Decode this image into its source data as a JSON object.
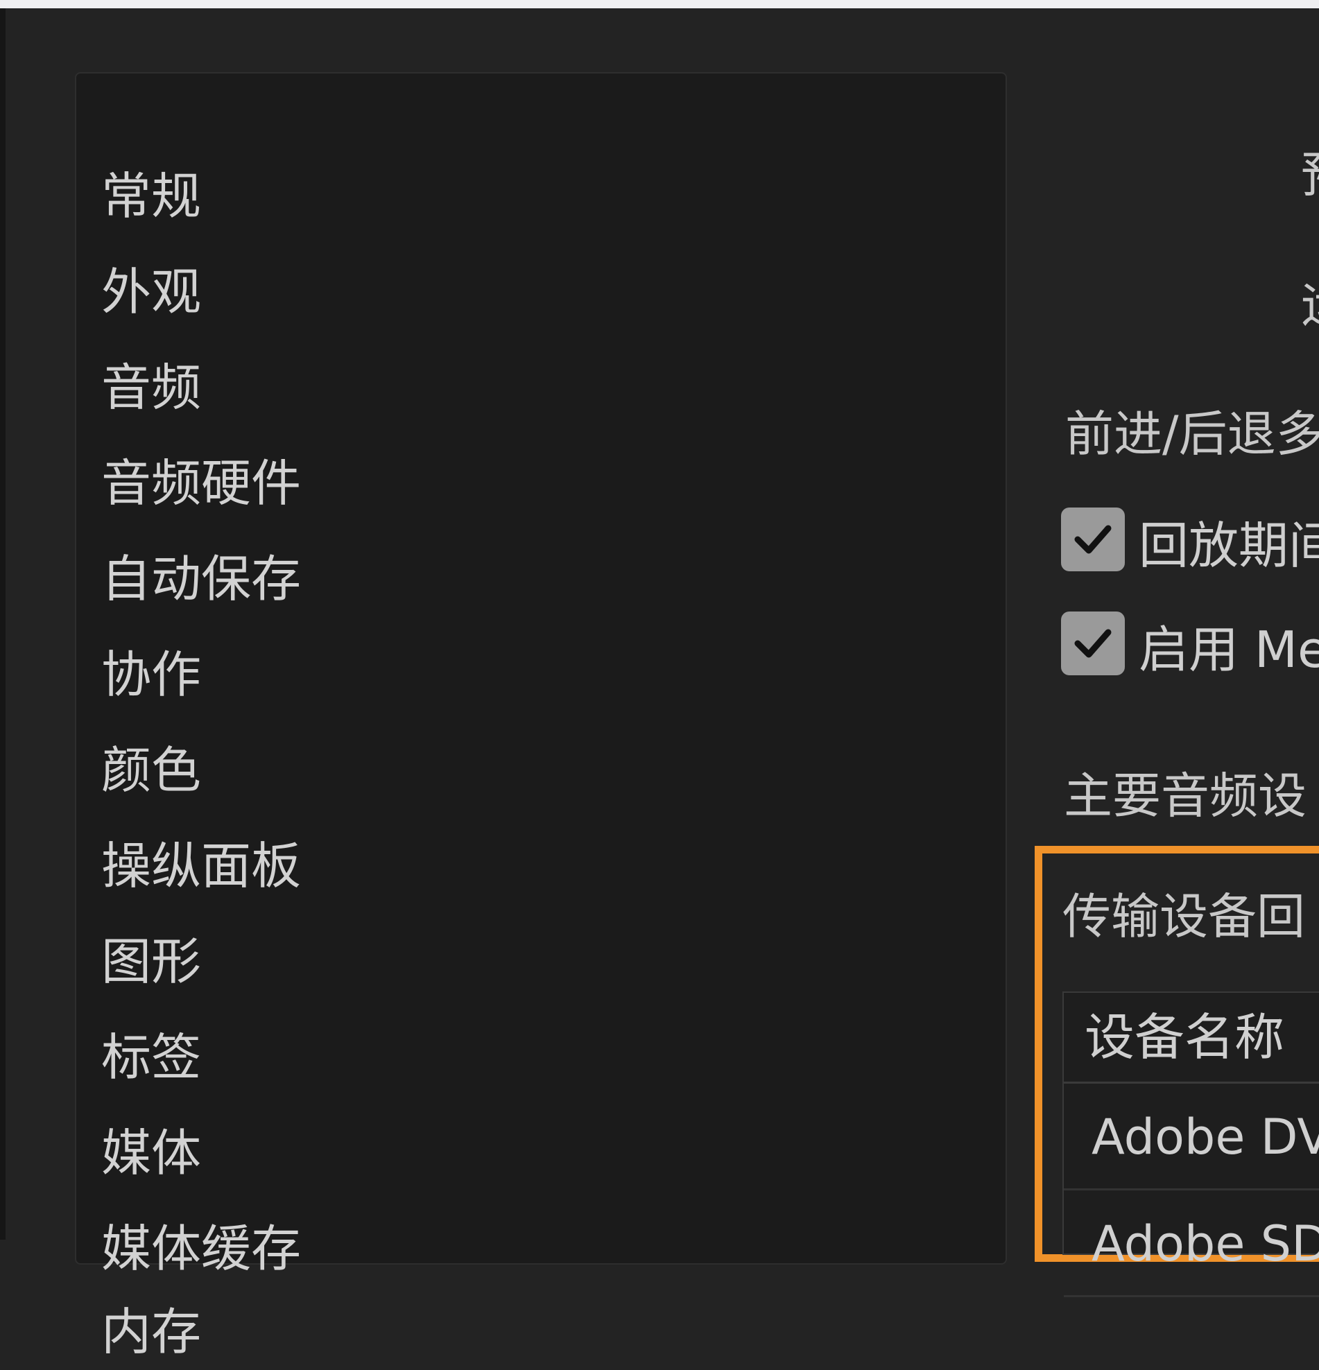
{
  "sidebar": {
    "items": [
      {
        "label": "常规"
      },
      {
        "label": "外观"
      },
      {
        "label": "音频"
      },
      {
        "label": "音频硬件"
      },
      {
        "label": "自动保存"
      },
      {
        "label": "协作"
      },
      {
        "label": "颜色"
      },
      {
        "label": "操纵面板"
      },
      {
        "label": "图形"
      },
      {
        "label": "标签"
      },
      {
        "label": "媒体"
      },
      {
        "label": "媒体缓存"
      },
      {
        "label": "内存"
      }
    ]
  },
  "settings": {
    "label_1": "预",
    "label_2": "运",
    "scrub_label": "前进/后退多",
    "checkbox_1": {
      "label": "回放期间",
      "checked": true
    },
    "checkbox_2": {
      "label": "启用 Me",
      "checked": true
    },
    "main_audio_label": "主要音频设",
    "transmit_label": "传输设备回"
  },
  "device_table": {
    "header": "设备名称",
    "rows": [
      {
        "name": "Adobe DV"
      },
      {
        "name": "Adobe SDI"
      }
    ]
  },
  "colors": {
    "highlight": "#f0922a",
    "checkbox": "#9a9a9a"
  }
}
